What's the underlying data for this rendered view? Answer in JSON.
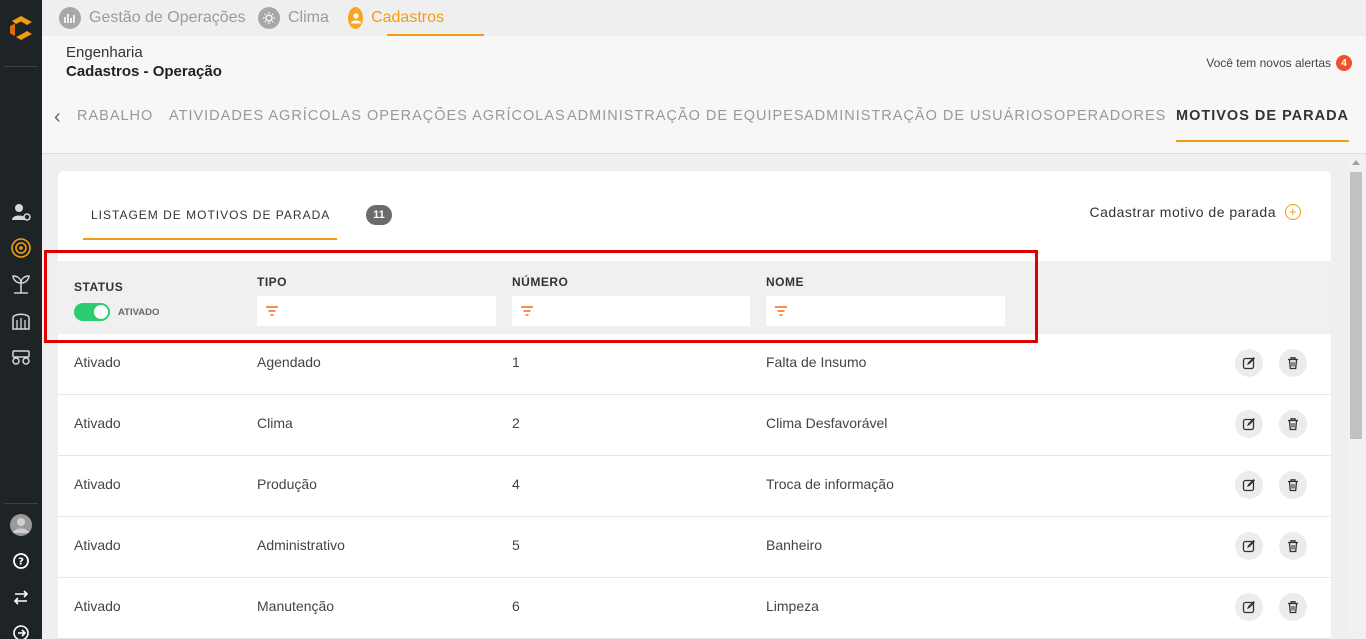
{
  "modules": [
    {
      "label": "Gestão de Operações",
      "icon": "operations-icon",
      "active": false
    },
    {
      "label": "Clima",
      "icon": "sun-icon",
      "active": false
    },
    {
      "label": "Cadastros",
      "icon": "user-icon",
      "active": true
    }
  ],
  "breadcrumb": {
    "level1": "Engenharia",
    "level2": "Cadastros - Operação"
  },
  "alerts": {
    "text": "Você tem novos alertas",
    "count": "4"
  },
  "subnav": {
    "tabs": [
      {
        "label": "RABALHO",
        "active": false
      },
      {
        "label": "ATIVIDADES AGRÍCOLAS",
        "active": false
      },
      {
        "label": "OPERAÇÕES AGRÍCOLAS",
        "active": false
      },
      {
        "label": "ADMINISTRAÇÃO DE EQUIPES",
        "active": false
      },
      {
        "label": "ADMINISTRAÇÃO DE USUÁRIOS",
        "active": false
      },
      {
        "label": "OPERADORES",
        "active": false
      },
      {
        "label": "MOTIVOS DE PARADA",
        "active": true
      }
    ]
  },
  "list": {
    "tab_label": "LISTAGEM DE MOTIVOS DE PARADA",
    "count": "11",
    "add_label": "Cadastrar motivo de parada"
  },
  "filters": {
    "status_label": "STATUS",
    "status_toggle_label": "ATIVADO",
    "status_on": true,
    "tipo_label": "TIPO",
    "numero_label": "NÚMERO",
    "nome_label": "NOME"
  },
  "rows": [
    {
      "status": "Ativado",
      "tipo": "Agendado",
      "numero": "1",
      "nome": "Falta de Insumo"
    },
    {
      "status": "Ativado",
      "tipo": "Clima",
      "numero": "2",
      "nome": "Clima Desfavorável"
    },
    {
      "status": "Ativado",
      "tipo": "Produção",
      "numero": "4",
      "nome": "Troca de informação"
    },
    {
      "status": "Ativado",
      "tipo": "Administrativo",
      "numero": "5",
      "nome": "Banheiro"
    },
    {
      "status": "Ativado",
      "tipo": "Manutenção",
      "numero": "6",
      "nome": "Limpeza"
    }
  ],
  "colors": {
    "accent": "#f39c12",
    "highlight": "#e00000",
    "toggle": "#2ecc71",
    "rail": "#1e2326"
  },
  "sidebar_icons": [
    "user-settings-icon",
    "target-icon",
    "plant-icon",
    "silo-icon",
    "tractor-icon",
    "avatar",
    "help-icon",
    "swap-icon",
    "logout-icon"
  ]
}
